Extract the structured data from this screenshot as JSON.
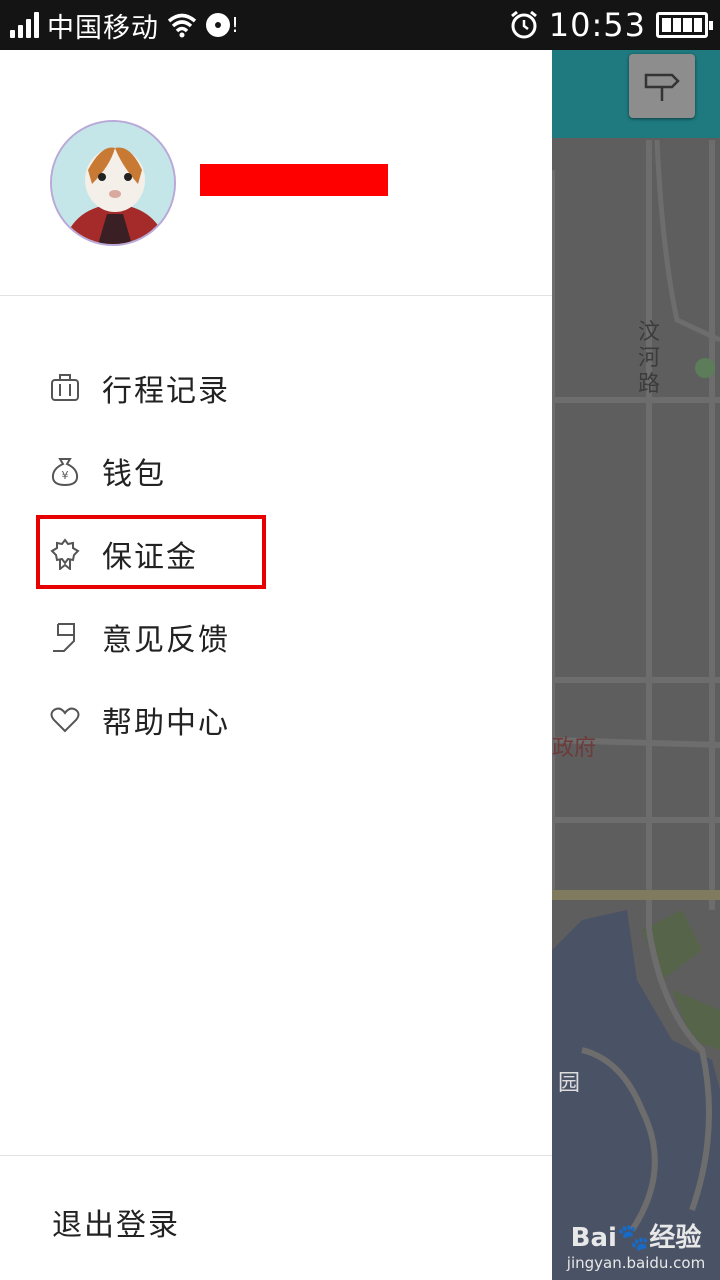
{
  "status_bar": {
    "carrier": "中国移动",
    "time": "10:53",
    "notification_icon": "!"
  },
  "map": {
    "road_label": "汶河路",
    "poi_label": "政府",
    "park_label": "园",
    "watermark_brand": "Bai",
    "watermark_suffix": "经验",
    "watermark_url": "jingyan.baidu.com"
  },
  "drawer": {
    "menu": [
      {
        "label": "行程记录",
        "icon": "luggage-icon"
      },
      {
        "label": "钱包",
        "icon": "money-bag-icon"
      },
      {
        "label": "保证金",
        "icon": "badge-icon"
      },
      {
        "label": "意见反馈",
        "icon": "feedback-icon"
      },
      {
        "label": "帮助中心",
        "icon": "heart-icon"
      }
    ],
    "logout_label": "退出登录"
  },
  "colors": {
    "map_header": "#1e7a7f",
    "highlight_border": "#e60000",
    "redaction": "#ff0000"
  }
}
